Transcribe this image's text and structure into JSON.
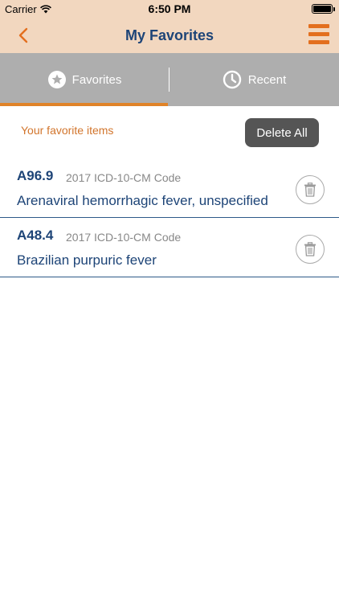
{
  "status_bar": {
    "carrier": "Carrier",
    "time": "6:50 PM"
  },
  "nav": {
    "title": "My Favorites",
    "back_icon": "chevron-left-icon",
    "menu_icon": "hamburger-menu-icon"
  },
  "tabs": [
    {
      "label": "Favorites",
      "icon": "star-icon",
      "active": true
    },
    {
      "label": "Recent",
      "icon": "clock-icon",
      "active": false
    }
  ],
  "favorites": {
    "section_label": "Your favorite items",
    "delete_all_label": "Delete All",
    "items": [
      {
        "code": "A96.9",
        "type": "2017 ICD-10-CM Code",
        "description": "Arenaviral hemorrhagic fever, unspecified"
      },
      {
        "code": "A48.4",
        "type": "2017 ICD-10-CM Code",
        "description": "Brazilian purpuric fever"
      }
    ]
  },
  "colors": {
    "header_bg": "#f2d7bf",
    "accent_orange": "#e36f1e",
    "title_blue": "#1d4477",
    "tab_bg": "#aeaeae",
    "delete_button_bg": "#555555"
  }
}
